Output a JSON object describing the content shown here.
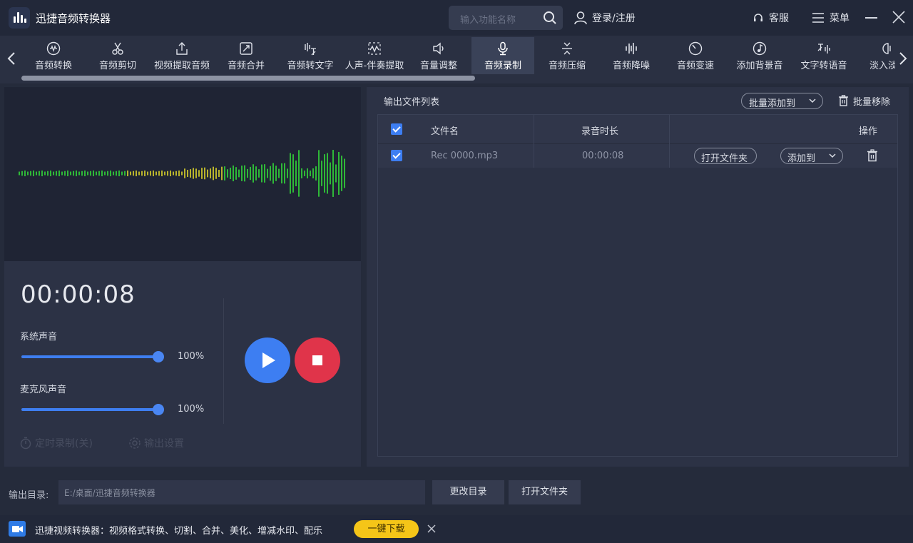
{
  "app": {
    "title": "迅捷音频转换器"
  },
  "header": {
    "search_placeholder": "输入功能名称",
    "login_label": "登录/注册",
    "service_label": "客服",
    "menu_label": "菜单"
  },
  "toolbar": {
    "active_index": 7,
    "items": [
      {
        "label": "音频转换",
        "icon": "waveform-circle-icon"
      },
      {
        "label": "音频剪切",
        "icon": "scissors-icon"
      },
      {
        "label": "视频提取音频",
        "icon": "upload-icon"
      },
      {
        "label": "音频合并",
        "icon": "merge-icon"
      },
      {
        "label": "音频转文字",
        "icon": "speech-to-text-icon"
      },
      {
        "label": "人声-伴奏提取",
        "icon": "vocal-extract-icon"
      },
      {
        "label": "音量调整",
        "icon": "speaker-icon"
      },
      {
        "label": "音频录制",
        "icon": "microphone-icon"
      },
      {
        "label": "音频压缩",
        "icon": "compress-icon"
      },
      {
        "label": "音频降噪",
        "icon": "equalizer-icon"
      },
      {
        "label": "音频变速",
        "icon": "speed-dial-icon"
      },
      {
        "label": "添加背景音",
        "icon": "music-note-icon"
      },
      {
        "label": "文字转语音",
        "icon": "text-to-speech-icon"
      },
      {
        "label": "淡入淡出",
        "icon": "fade-icon"
      }
    ],
    "scroll_fraction": 0.52
  },
  "recorder": {
    "timer": "00:00:08",
    "system_sound_label": "系统声音",
    "system_sound_value": "100%",
    "system_sound_level": 1.0,
    "mic_sound_label": "麦克风声音",
    "mic_sound_value": "100%",
    "mic_sound_level": 1.0,
    "timer_record_label": "定时录制(关)",
    "output_settings_label": "输出设置"
  },
  "file_list": {
    "title": "输出文件列表",
    "batch_add_label": "批量添加到",
    "batch_remove_label": "批量移除",
    "columns": {
      "name": "文件名",
      "duration": "录音时长",
      "actions": "操作"
    },
    "rows": [
      {
        "name": "Rec 0000.mp3",
        "duration": "00:00:08",
        "open_folder": "打开文件夹",
        "add_to": "添加到"
      }
    ]
  },
  "output": {
    "label": "输出目录:",
    "path": "E:/桌面/迅捷音频转换器",
    "change_label": "更改目录",
    "open_label": "打开文件夹"
  },
  "ad": {
    "text": "迅捷视频转换器：视频格式转换、切割、合并、美化、增减水印、配乐",
    "button": "一键下载"
  },
  "colors": {
    "accent": "#3d7ef2",
    "stop": "#e0344a",
    "ad_button": "#f5c518",
    "wave_green": "#2fb838",
    "wave_yellow": "#b9b42c"
  }
}
